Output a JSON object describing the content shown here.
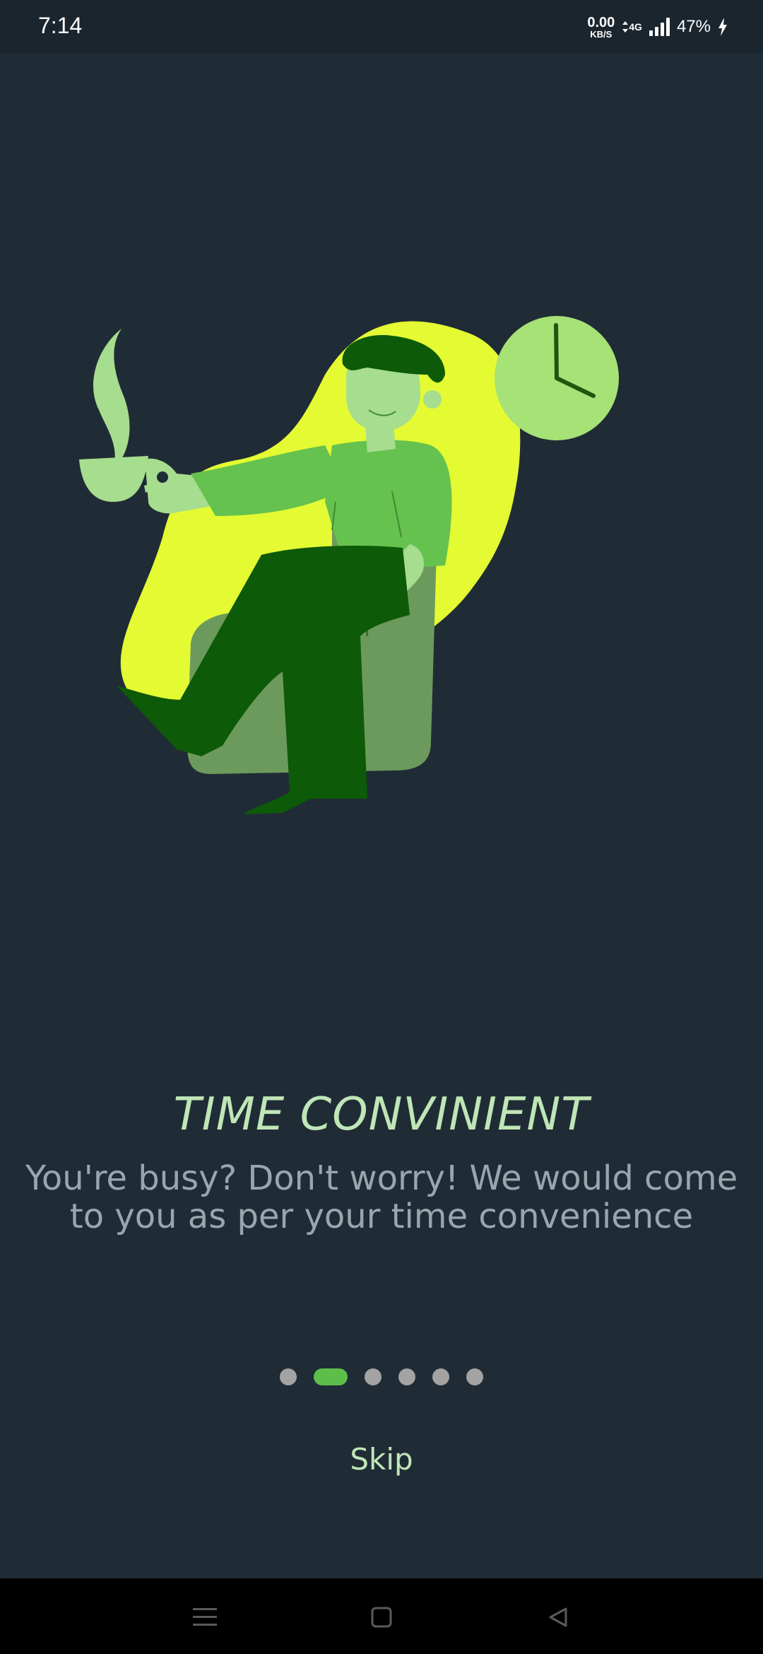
{
  "status_bar": {
    "time": "7:14",
    "net_speed_value": "0.00",
    "net_speed_unit": "KB/S",
    "network_type": "4G",
    "battery": "47%",
    "icons": [
      "data-arrows-icon",
      "signal-icon",
      "charging-bolt-icon"
    ]
  },
  "onboarding": {
    "title": "TIME CONVINIENT",
    "description": "You're busy? Don't worry! We would come to you as per your time convenience",
    "illustration": "man-relaxing-with-coffee-and-clock-illustration",
    "page_count": 6,
    "active_page": 2,
    "skip_label": "Skip"
  },
  "navigation_bar": {
    "buttons": [
      "menu-icon",
      "home-icon",
      "back-icon"
    ]
  },
  "colors": {
    "background": "#202c35",
    "accent": "#5cbf4a",
    "title": "#bfe6b7",
    "text_muted": "#9aa6ae",
    "blob": "#e4fb33",
    "dot_inactive": "#a3a3a3"
  }
}
